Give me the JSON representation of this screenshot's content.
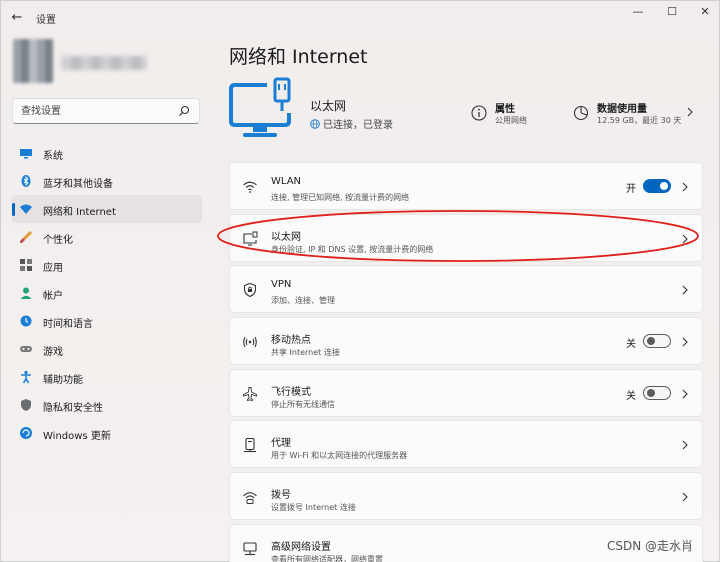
{
  "window": {
    "app_title": "设置",
    "back": "←",
    "controls": {
      "minimize": "—",
      "maximize": "☐",
      "close": "✕"
    }
  },
  "sidebar": {
    "search": {
      "placeholder": "查找设置",
      "value": ""
    },
    "items": [
      {
        "label": "系统",
        "icon": "display-icon",
        "active": false
      },
      {
        "label": "蓝牙和其他设备",
        "icon": "bluetooth-icon",
        "active": false
      },
      {
        "label": "网络和 Internet",
        "icon": "wifi-icon",
        "active": true
      },
      {
        "label": "个性化",
        "icon": "brush-icon",
        "active": false
      },
      {
        "label": "应用",
        "icon": "apps-icon",
        "active": false
      },
      {
        "label": "帐户",
        "icon": "person-icon",
        "active": false
      },
      {
        "label": "时间和语言",
        "icon": "globe-clock-icon",
        "active": false
      },
      {
        "label": "游戏",
        "icon": "gamepad-icon",
        "active": false
      },
      {
        "label": "辅助功能",
        "icon": "accessibility-icon",
        "active": false
      },
      {
        "label": "隐私和安全性",
        "icon": "shield-icon",
        "active": false
      },
      {
        "label": "Windows 更新",
        "icon": "update-icon",
        "active": false
      }
    ]
  },
  "main": {
    "title": "网络和 Internet",
    "header": {
      "name": "以太网",
      "status": "已连接，已登录",
      "properties": {
        "label": "属性",
        "sub": "公用网络"
      },
      "usage": {
        "label": "数据使用量",
        "sub": "12.59 GB，最近 30 天"
      }
    },
    "cards": [
      {
        "title": "WLAN",
        "sub": "连接, 管理已知网络, 按流量计费的网络",
        "icon": "wifi-icon",
        "toggle": "on",
        "toggle_label": "开"
      },
      {
        "title": "以太网",
        "sub": "身份验证, IP 和 DNS 设置, 按流量计费的网络",
        "icon": "ethernet-icon"
      },
      {
        "title": "VPN",
        "sub": "添加、连接、管理",
        "icon": "vpn-shield-icon"
      },
      {
        "title": "移动热点",
        "sub": "共享 Internet 连接",
        "icon": "hotspot-icon",
        "toggle": "off",
        "toggle_label": "关"
      },
      {
        "title": "飞行模式",
        "sub": "停止所有无线通信",
        "icon": "airplane-icon",
        "toggle": "off",
        "toggle_label": "关"
      },
      {
        "title": "代理",
        "sub": "用于 Wi-Fi 和以太网连接的代理服务器",
        "icon": "proxy-icon"
      },
      {
        "title": "拨号",
        "sub": "设置拨号 Internet 连接",
        "icon": "dialup-icon"
      },
      {
        "title": "高级网络设置",
        "sub": "查看所有网络适配器，网络重置",
        "icon": "network-pc-icon"
      }
    ]
  },
  "watermark": "CSDN @走水肖",
  "colors": {
    "accent": "#0067c0",
    "annotation": "#e0201b",
    "icon_blue": "#1a7fd4"
  }
}
